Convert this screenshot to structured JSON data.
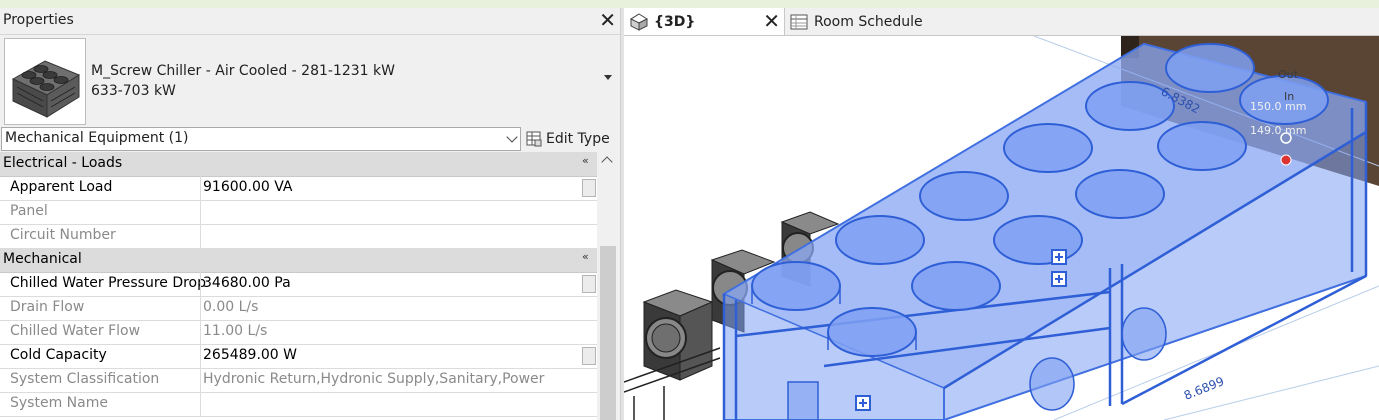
{
  "properties": {
    "title": "Properties",
    "type_name_line1": "M_Screw Chiller - Air Cooled - 281-1231 kW",
    "type_name_line2": "633-703 kW",
    "filter": "Mechanical Equipment (1)",
    "edit_type": "Edit Type",
    "groups": [
      {
        "label": "Electrical - Loads",
        "rows": [
          {
            "name": "Apparent Load",
            "value": "91600.00 VA",
            "enabled": true
          },
          {
            "name": "Panel",
            "value": "",
            "enabled": false
          },
          {
            "name": "Circuit Number",
            "value": "",
            "enabled": false
          }
        ]
      },
      {
        "label": "Mechanical",
        "rows": [
          {
            "name": "Chilled Water Pressure Drop",
            "value": "34680.00 Pa",
            "enabled": true
          },
          {
            "name": "Drain Flow",
            "value": "0.00 L/s",
            "enabled": false
          },
          {
            "name": "Chilled Water Flow",
            "value": "11.00 L/s",
            "enabled": false
          },
          {
            "name": "Cold Capacity",
            "value": "265489.00 W",
            "enabled": true
          },
          {
            "name": "System Classification",
            "value": "Hydronic Return,Hydronic Supply,Sanitary,Power",
            "enabled": false
          },
          {
            "name": "System Name",
            "value": "",
            "enabled": false
          }
        ]
      }
    ]
  },
  "tabs": {
    "view_3d": "{3D}",
    "room_schedule": "Room Schedule"
  },
  "viewport": {
    "dim_top": "6.8382",
    "dim_bottom": "8.6899",
    "label_out": "Out",
    "label_in": "In",
    "size_1": "150.0 mm",
    "size_2": "149.0 mm"
  },
  "colors": {
    "selection_blue": "#3f6fe0",
    "selection_fill": "#7fa0f2",
    "panel_bg": "#f0f0f0"
  }
}
